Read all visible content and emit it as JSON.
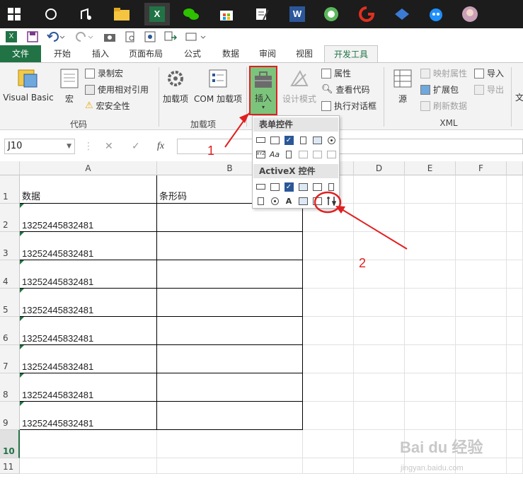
{
  "taskbar": {
    "items": [
      {
        "icon": "windows-start-icon"
      },
      {
        "icon": "cortana-icon"
      },
      {
        "icon": "music-app-icon"
      },
      {
        "icon": "file-explorer-icon"
      },
      {
        "icon": "excel-icon",
        "label": "X"
      },
      {
        "icon": "wechat-icon"
      },
      {
        "icon": "store-icon"
      },
      {
        "icon": "notepad-icon"
      },
      {
        "icon": "word-icon",
        "label": "W"
      },
      {
        "icon": "green-app-icon"
      },
      {
        "icon": "red-app-icon"
      },
      {
        "icon": "blue-app-icon"
      },
      {
        "icon": "cat-app-icon"
      },
      {
        "icon": "avatar-app-icon"
      }
    ]
  },
  "tabs": {
    "file": "文件",
    "items": [
      "开始",
      "插入",
      "页面布局",
      "公式",
      "数据",
      "审阅",
      "视图",
      "开发工具"
    ],
    "active": "开发工具"
  },
  "ribbon": {
    "visual_basic": "Visual Basic",
    "macros": "宏",
    "record_macro": "录制宏",
    "relative_ref": "使用相对引用",
    "macro_security": "宏安全性",
    "group_code": "代码",
    "addins": "加载项",
    "com_addins": "COM 加载项",
    "group_addins": "加载项",
    "insert": "插入",
    "design_mode": "设计模式",
    "properties": "属性",
    "view_code": "查看代码",
    "run_dialog": "执行对话框",
    "source": "源",
    "map_props": "映射属性",
    "expansion_pack": "扩展包",
    "refresh_data": "刷新数据",
    "import": "导入",
    "export": "导出",
    "group_xml": "XML",
    "doc_cut": "文"
  },
  "formula_bar": {
    "name_box": "J10",
    "cancel": "✕",
    "enter": "✓",
    "fx": "fx",
    "content": ""
  },
  "popup": {
    "form_controls": "表单控件",
    "activex_controls": "ActiveX 控件"
  },
  "columns": [
    "A",
    "B",
    "C",
    "D",
    "E",
    "F"
  ],
  "rows": [
    {
      "num": "1",
      "a": "数据",
      "b": "条形码"
    },
    {
      "num": "2",
      "a": "13252445832481",
      "b": ""
    },
    {
      "num": "3",
      "a": "13252445832481",
      "b": ""
    },
    {
      "num": "4",
      "a": "13252445832481",
      "b": ""
    },
    {
      "num": "5",
      "a": "13252445832481",
      "b": ""
    },
    {
      "num": "6",
      "a": "13252445832481",
      "b": ""
    },
    {
      "num": "7",
      "a": "13252445832481",
      "b": ""
    },
    {
      "num": "8",
      "a": "13252445832481",
      "b": ""
    },
    {
      "num": "9",
      "a": "13252445832481",
      "b": ""
    },
    {
      "num": "10",
      "a": "",
      "b": ""
    },
    {
      "num": "11",
      "a": "",
      "b": ""
    }
  ],
  "annotations": {
    "step1": "1",
    "step2": "2",
    "color": "#e02020"
  },
  "watermark": {
    "logo": "Bai du 经验",
    "url": "jingyan.baidu.com"
  },
  "colors": {
    "excel_green": "#217346",
    "accent_highlight": "#66bb66"
  }
}
